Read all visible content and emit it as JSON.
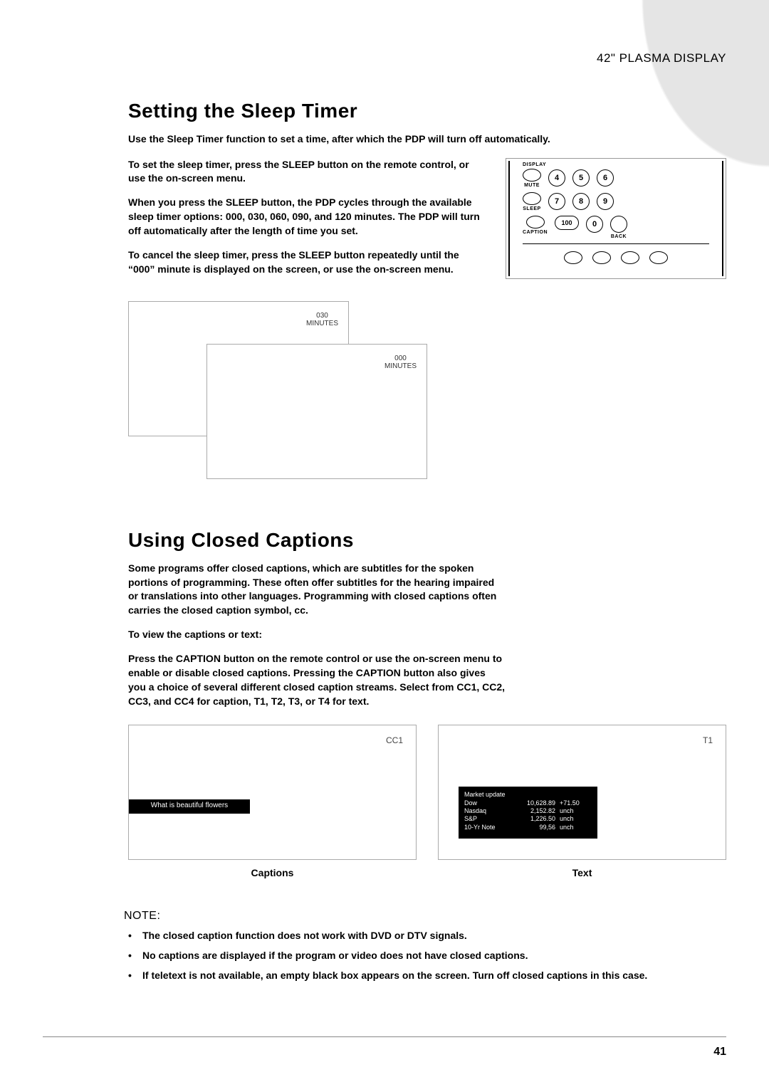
{
  "header": "42\" PLASMA DISPLAY",
  "section1": {
    "title": "Setting the Sleep Timer",
    "intro": "Use the Sleep Timer function to set a time, after which the PDP will turn off automatically.",
    "p1": "To set the sleep timer, press the SLEEP button on the remote control, or use the on-screen menu.",
    "p2": "When you press the SLEEP button, the PDP cycles through the available sleep timer options: 000, 030, 060, 090, and 120 minutes. The PDP will turn off automatically after the length of time you set.",
    "p3": "To cancel the sleep timer, press the SLEEP button repeatedly until the “000” minute is displayed on the screen, or use the on-screen menu."
  },
  "remote": {
    "display": "DISPLAY",
    "mute": "MUTE",
    "sleep": "SLEEP",
    "caption": "CAPTION",
    "back": "BACK",
    "btn4": "4",
    "btn5": "5",
    "btn6": "6",
    "btn7": "7",
    "btn8": "8",
    "btn9": "9",
    "btn100": "100",
    "btn0": "0"
  },
  "screens": {
    "s1_val": "030",
    "s1_unit": "MINUTES",
    "s2_val": "000",
    "s2_unit": "MINUTES"
  },
  "section2": {
    "title": "Using Closed Captions",
    "p1": "Some programs offer closed captions, which are subtitles for the spoken portions of programming. These often offer subtitles for the hearing impaired or translations into other languages. Programming with closed captions often carries the closed caption symbol, cc.",
    "p2": "To view the captions or text:",
    "p3": "Press the CAPTION button on the remote control or use the on-screen menu to enable or disable closed captions. Pressing the CAPTION button also gives you a choice of several different closed caption streams. Select from CC1, CC2, CC3, and CC4 for caption, T1, T2, T3, or T4 for text."
  },
  "captions_box": {
    "tag": "CC1",
    "band": "What is beautiful flowers",
    "label": "Captions"
  },
  "text_box": {
    "tag": "T1",
    "title": "Market update",
    "rows": [
      {
        "c1": "Dow",
        "c2": "10,628.89",
        "c3": "+71.50"
      },
      {
        "c1": "Nasdaq",
        "c2": "2,152.82",
        "c3": "unch"
      },
      {
        "c1": "S&P",
        "c2": "1,226.50",
        "c3": "unch"
      },
      {
        "c1": "10-Yr Note",
        "c2": "99,56",
        "c3": "unch"
      }
    ],
    "label": "Text"
  },
  "notes": {
    "heading": "NOTE:",
    "items": [
      "The closed caption function does not work with DVD or DTV signals.",
      "No captions are displayed if the program or video does not have closed captions.",
      "If teletext is not available, an empty black box appears on the screen. Turn off closed captions in this case."
    ]
  },
  "page_number": "41"
}
